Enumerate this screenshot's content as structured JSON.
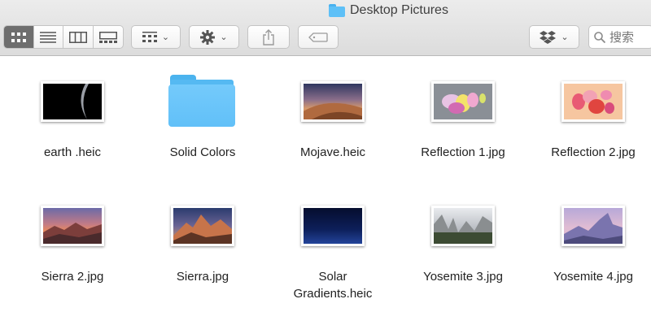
{
  "window": {
    "title": "Desktop Pictures",
    "title_icon": "folder-icon"
  },
  "toolbar": {
    "view_modes": [
      {
        "name": "icon-view",
        "icon": "grid-icon",
        "active": true
      },
      {
        "name": "list-view",
        "icon": "list-icon",
        "active": false
      },
      {
        "name": "column-view",
        "icon": "columns-icon",
        "active": false
      },
      {
        "name": "gallery-view",
        "icon": "gallery-icon",
        "active": false
      }
    ],
    "group_button_icon": "group-grid-icon",
    "action_button_icon": "gear-icon",
    "share_button_icon": "share-icon",
    "tag_button_icon": "tag-icon",
    "dropbox_button_icon": "dropbox-icon",
    "caret": "⌄",
    "search": {
      "placeholder": "搜索",
      "value": ""
    }
  },
  "items": [
    {
      "name": "earth .heic",
      "kind": "image",
      "colors": [
        "#000000",
        "#1a1a1a"
      ]
    },
    {
      "name": "Solid Colors",
      "kind": "folder",
      "colors": [
        "#6cc6fa"
      ]
    },
    {
      "name": "Mojave.heic",
      "kind": "image",
      "colors": [
        "#3b3f63",
        "#c9855a"
      ]
    },
    {
      "name": "Reflection 1.jpg",
      "kind": "image",
      "colors": [
        "#8a8f96",
        "#d9e26b"
      ]
    },
    {
      "name": "Reflection 2.jpg",
      "kind": "image",
      "colors": [
        "#f6c6a0",
        "#e6505e"
      ]
    },
    {
      "name": "Sierra 2.jpg",
      "kind": "image",
      "colors": [
        "#7b6aa0",
        "#e27a63"
      ]
    },
    {
      "name": "Sierra.jpg",
      "kind": "image",
      "colors": [
        "#2e3e6e",
        "#d9854f"
      ]
    },
    {
      "name": [
        "Solar",
        "Gradients.heic"
      ],
      "kind": "image",
      "colors": [
        "#0a1742",
        "#1f3a8c"
      ]
    },
    {
      "name": "Yosemite 3.jpg",
      "kind": "image",
      "colors": [
        "#d8dbdf",
        "#3c4b33"
      ]
    },
    {
      "name": "Yosemite 4.jpg",
      "kind": "image",
      "colors": [
        "#c7b6d8",
        "#6d6ca6"
      ]
    }
  ]
}
